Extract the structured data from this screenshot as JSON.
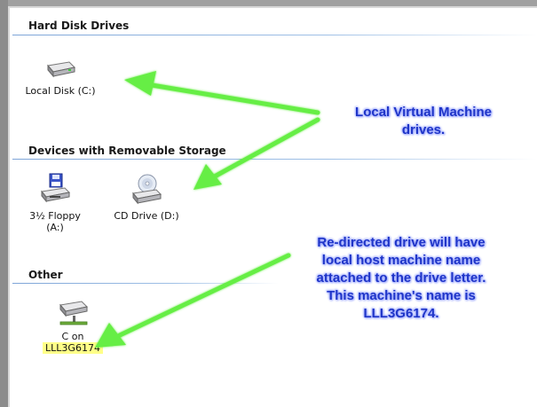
{
  "groups": {
    "hard_disk": {
      "title": "Hard Disk Drives",
      "items": [
        {
          "label": "Local Disk (C:)",
          "icon": "hard-drive-icon"
        }
      ]
    },
    "removable": {
      "title": "Devices with Removable Storage",
      "items": [
        {
          "label": "3½ Floppy",
          "sublabel": "(A:)",
          "icon": "floppy-drive-icon"
        },
        {
          "label": "CD Drive (D:)",
          "icon": "cd-drive-icon"
        }
      ]
    },
    "other": {
      "title": "Other",
      "items": [
        {
          "label": "C on",
          "sublabel": "LLL3G6174",
          "icon": "network-drive-icon"
        }
      ]
    }
  },
  "callouts": {
    "top": [
      "Local Virtual Machine",
      "drives."
    ],
    "bottom": [
      "Re-directed drive will have",
      "local host machine name",
      "attached to the drive letter.",
      "This machine's name is",
      "LLL3G6174."
    ]
  },
  "colors": {
    "callout_text": "#1f35c8",
    "arrow": "#66ee44",
    "highlight": "#ffff88",
    "rule": "#7ea5d8"
  }
}
